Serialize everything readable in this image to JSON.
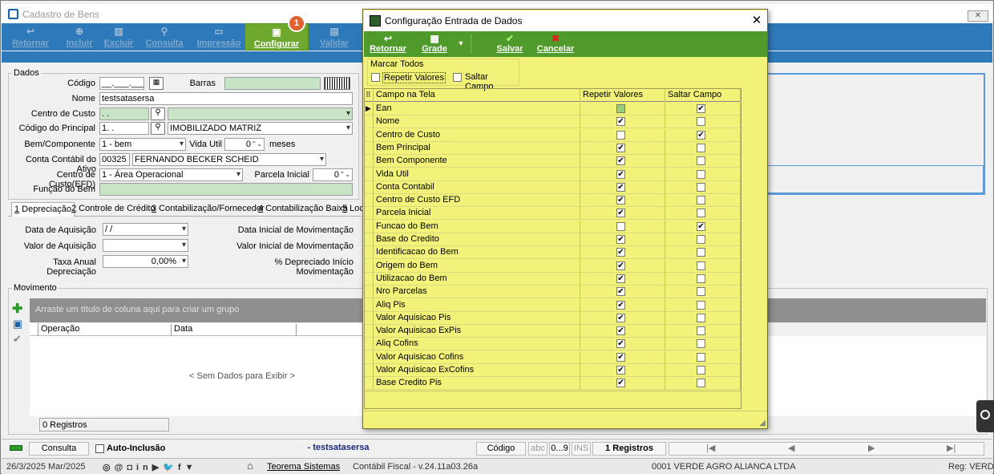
{
  "window": {
    "title": "Cadastro de Bens"
  },
  "toolbar": {
    "retornar": "Retornar",
    "incluir": "Incluir",
    "excluir": "Excluir",
    "consulta": "Consulta",
    "impressao": "Impressão",
    "configurar": "Configurar",
    "validar": "Validar",
    "badge": "1"
  },
  "dados": {
    "legend": "Dados",
    "codigo_label": "Código",
    "codigo_value": "__.___.___",
    "barras_label": "Barras",
    "nome_label": "Nome",
    "nome_value": "testsatasersa",
    "centro_custo_label": "Centro de Custo",
    "centro_custo_value": ".  .",
    "codigo_principal_label": "Código do Principal",
    "codigo_principal_value": "1.  .",
    "codigo_principal_desc": "IMOBILIZADO MATRIZ",
    "bem_componente_label": "Bem/Componente",
    "bem_componente_value": "1 - bem",
    "vida_util_label": "Vida Util",
    "vida_util_value": "0",
    "meses": "meses",
    "conta_contabil_label": "Conta Contábil do Ativo",
    "conta_contabil_code": "00325",
    "conta_contabil_name": "FERNANDO BECKER SCHEID",
    "centro_efd_label": "Centro de Custo(EFD)",
    "centro_efd_value": "1 - Área Operacional",
    "parcela_inicial_label": "Parcela Inicial",
    "parcela_inicial_value": "0",
    "funcao_label": "Função do Bem"
  },
  "tabs": [
    {
      "num": "1",
      "label": " Depreciação"
    },
    {
      "num": "2",
      "label": " Controle de Crédito"
    },
    {
      "num": "3",
      "label": " Contabilização/Fornecedor"
    },
    {
      "num": "4",
      "label": " Contabilização Baixa"
    },
    {
      "num": "5",
      "label": " Loc"
    }
  ],
  "depreciacao": {
    "data_aquisicao_label": "Data de Aquisição",
    "data_aquisicao_value": " / /",
    "valor_aquisicao_label": "Valor de Aquisição",
    "taxa_label": "Taxa Anual Depreciação",
    "taxa_value": "0,00%",
    "data_mov_label": "Data Inicial de Movimentação",
    "valor_mov_label": "Valor Inicial de Movimentação",
    "perc_label": "% Depreciado Início Movimentação"
  },
  "movimento": {
    "legend": "Movimento",
    "group_hint": "Arraste um título de coluna aqui para criar um grupo",
    "col_operacao": "Operação",
    "col_data": "Data",
    "empty": "< Sem Dados para Exibir >",
    "registros": "0 Registros"
  },
  "statusbar": {
    "consulta": "Consulta",
    "auto_inclusao": "Auto-Inclusão",
    "record_name": "- testsatasersa",
    "codigo": "Código",
    "abc": "abc",
    "num": "0...9",
    "ins": "INS",
    "registros": "1 Registros"
  },
  "footer": {
    "date": "26/3/2025 Mar/2025",
    "company_link": "Teorema Sistemas",
    "version": "Contábil Fiscal - v.24.11a03.26a",
    "empresa": "0001 VERDE AGRO ALIANCA LTDA",
    "reg": "Reg: VERDE"
  },
  "dialog": {
    "title": "Configuração Entrada de Dados",
    "retornar": "Retornar",
    "grade": "Grade",
    "salvar": "Salvar",
    "cancelar": "Cancelar",
    "marcar_todos": "Marcar Todos",
    "repetir_valores": "Repetir Valores",
    "saltar_campo": "Saltar Campo",
    "col_campo": "Campo na Tela",
    "col_repetir": "Repetir Valores",
    "col_saltar": "Saltar Campo",
    "rows": [
      {
        "campo": "Ean",
        "repetir": false,
        "saltar": true
      },
      {
        "campo": "Nome",
        "repetir": true,
        "saltar": false
      },
      {
        "campo": "Centro de Custo",
        "repetir": false,
        "saltar": true
      },
      {
        "campo": "Bem Principal",
        "repetir": true,
        "saltar": false
      },
      {
        "campo": "Bem Componente",
        "repetir": true,
        "saltar": false
      },
      {
        "campo": "Vida Util",
        "repetir": true,
        "saltar": false
      },
      {
        "campo": "Conta Contabil",
        "repetir": true,
        "saltar": false
      },
      {
        "campo": "Centro de Custo EFD",
        "repetir": true,
        "saltar": false
      },
      {
        "campo": "Parcela Inicial",
        "repetir": true,
        "saltar": false
      },
      {
        "campo": "Funcao do Bem",
        "repetir": false,
        "saltar": true
      },
      {
        "campo": "Base do Credito",
        "repetir": true,
        "saltar": false
      },
      {
        "campo": "Identificacao do Bem",
        "repetir": true,
        "saltar": false
      },
      {
        "campo": "Origem do Bem",
        "repetir": true,
        "saltar": false
      },
      {
        "campo": "Utilizacao do Bem",
        "repetir": true,
        "saltar": false
      },
      {
        "campo": "Nro Parcelas",
        "repetir": true,
        "saltar": false
      },
      {
        "campo": "Aliq Pis",
        "repetir": true,
        "saltar": false
      },
      {
        "campo": "Valor Aquisicao Pis",
        "repetir": true,
        "saltar": false
      },
      {
        "campo": "Valor Aquisicao ExPis",
        "repetir": true,
        "saltar": false
      },
      {
        "campo": "Aliq Cofins",
        "repetir": true,
        "saltar": false
      },
      {
        "campo": "Valor Aquisicao Cofins",
        "repetir": true,
        "saltar": false
      },
      {
        "campo": "Valor Aquisicao ExCofins",
        "repetir": true,
        "saltar": false
      },
      {
        "campo": "Base Credito Pis",
        "repetir": true,
        "saltar": false
      }
    ]
  }
}
